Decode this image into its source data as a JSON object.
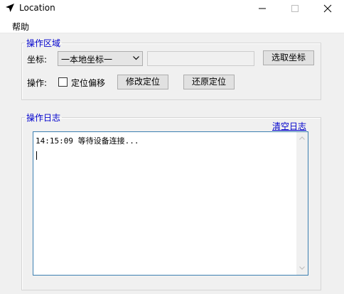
{
  "window": {
    "title": "Location",
    "icon": "navigation-arrow-icon",
    "controls": [
      "minimize-icon",
      "maximize-icon",
      "close-icon"
    ]
  },
  "menu": {
    "help": "帮助"
  },
  "operation_group": {
    "legend": "操作区域",
    "coord_label": "坐标:",
    "coord_select_value": "一本地坐标一",
    "coord_input_value": "",
    "pick_button": "选取坐标",
    "op_label": "操作:",
    "offset_checkbox_label": "定位偏移",
    "offset_checked": false,
    "modify_button": "修改定位",
    "restore_button": "还原定位"
  },
  "log_group": {
    "legend": "操作日志",
    "clear_link": "清空日志",
    "lines": [
      "14:15:09 等待设备连接..."
    ]
  }
}
